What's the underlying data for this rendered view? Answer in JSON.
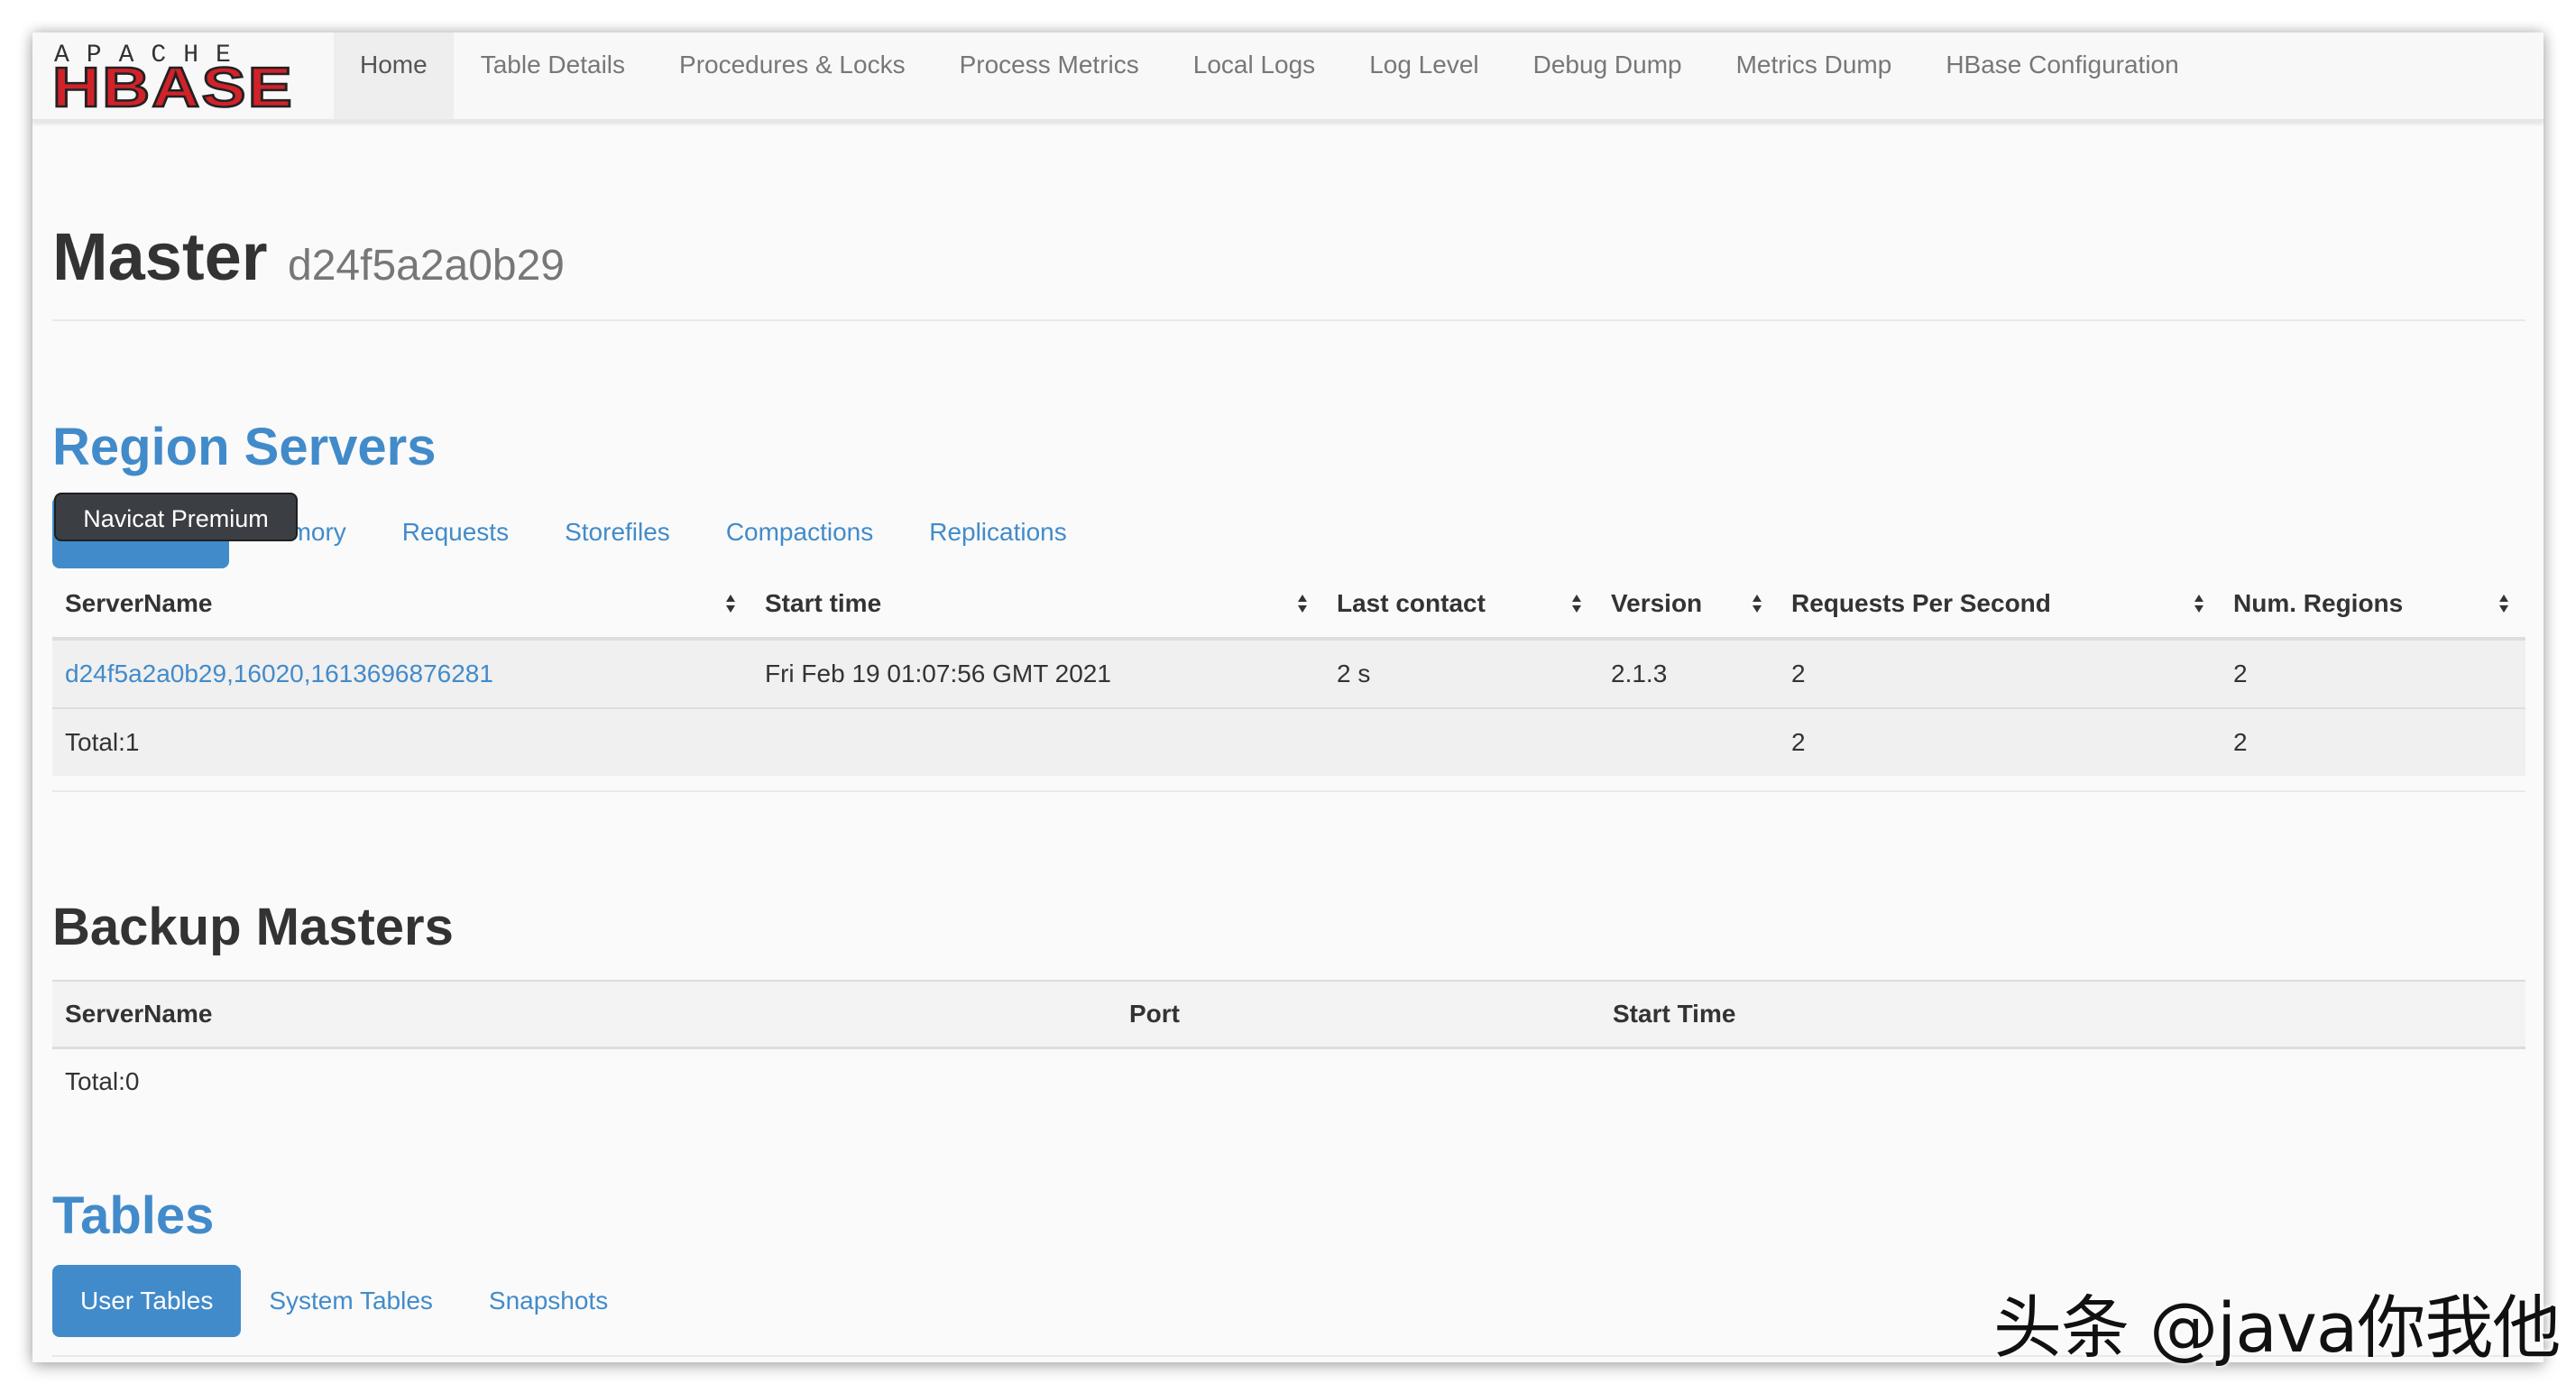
{
  "brand": {
    "logo_top": "APACHE",
    "logo_bottom": "HBASE"
  },
  "nav": {
    "items": [
      {
        "label": "Home"
      },
      {
        "label": "Table Details"
      },
      {
        "label": "Procedures & Locks"
      },
      {
        "label": "Process Metrics"
      },
      {
        "label": "Local Logs"
      },
      {
        "label": "Log Level"
      },
      {
        "label": "Debug Dump"
      },
      {
        "label": "Metrics Dump"
      },
      {
        "label": "HBase Configuration"
      }
    ],
    "active_index": 0
  },
  "page": {
    "title": "Master",
    "subtitle": "d24f5a2a0b29"
  },
  "region_servers": {
    "title": "Region Servers",
    "tabs": [
      {
        "label": ""
      },
      {
        "label": "emory"
      },
      {
        "label": "Requests"
      },
      {
        "label": "Storefiles"
      },
      {
        "label": "Compactions"
      },
      {
        "label": "Replications"
      }
    ],
    "tooltip": "Navicat Premium",
    "columns": [
      "ServerName",
      "Start time",
      "Last contact",
      "Version",
      "Requests Per Second",
      "Num. Regions"
    ],
    "rows": [
      [
        "d24f5a2a0b29,16020,1613696876281",
        "Fri Feb 19 01:07:56 GMT 2021",
        "2 s",
        "2.1.3",
        "2",
        "2"
      ]
    ],
    "total": [
      "Total:1",
      "",
      "",
      "",
      "2",
      "2"
    ]
  },
  "backup_masters": {
    "title": "Backup Masters",
    "columns": [
      "ServerName",
      "Port",
      "Start Time"
    ],
    "total": "Total:0"
  },
  "tables": {
    "title": "Tables",
    "tabs": [
      {
        "label": "User Tables"
      },
      {
        "label": "System Tables"
      },
      {
        "label": "Snapshots"
      }
    ]
  },
  "watermark": "头条 @java你我他",
  "colors": {
    "accent": "#428bca",
    "logo_red": "#d1222a",
    "text": "#333333",
    "muted": "#777777"
  }
}
